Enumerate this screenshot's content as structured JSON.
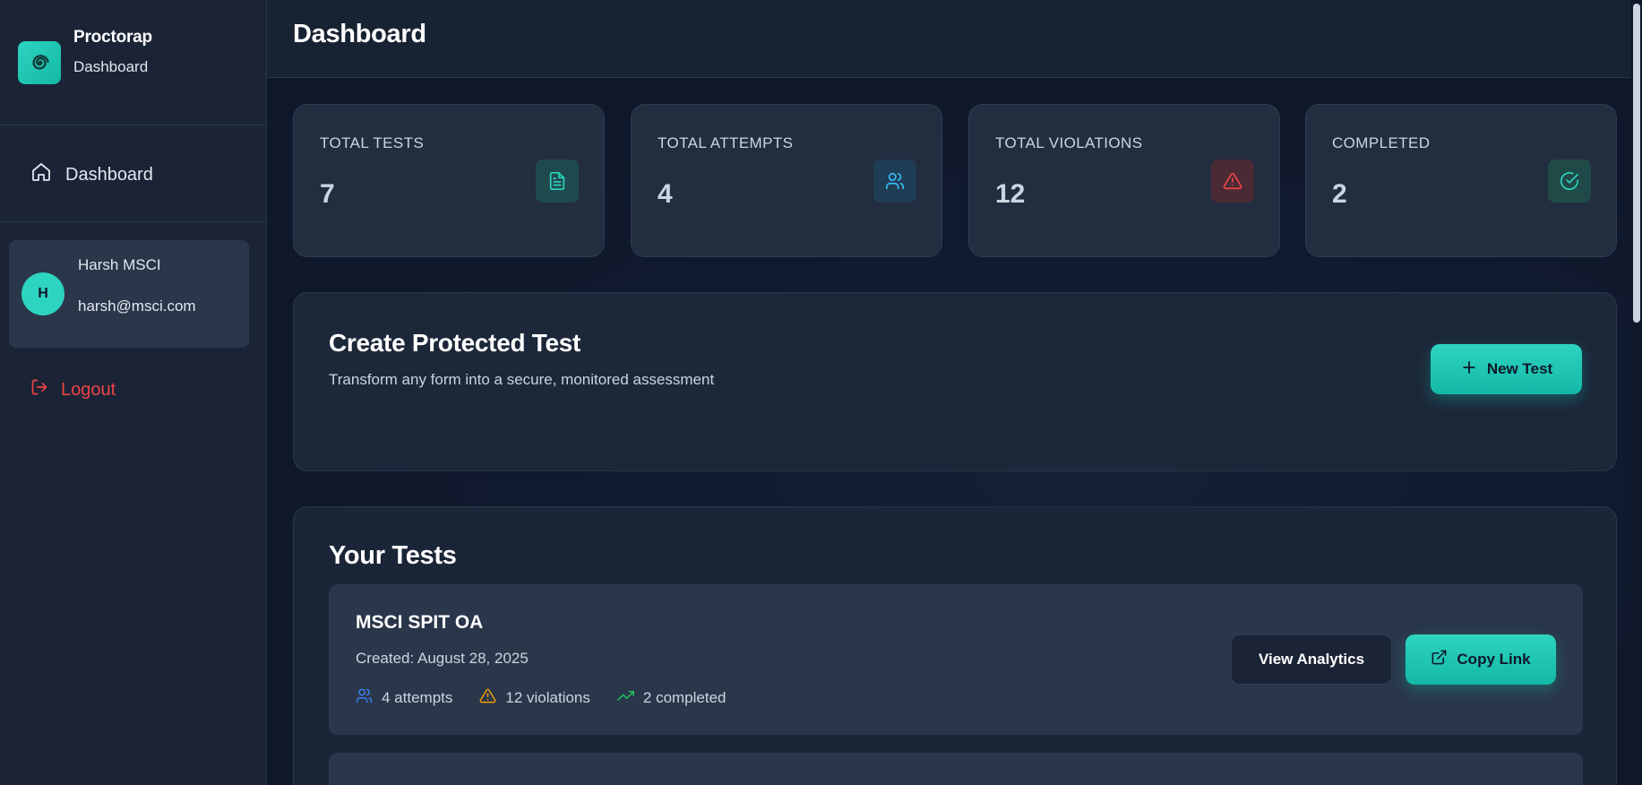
{
  "sidebar": {
    "brand_name": "Proctorap",
    "brand_subtitle": "Dashboard",
    "nav_items": [
      {
        "label": "Dashboard",
        "icon": "home-icon"
      }
    ],
    "user": {
      "initial": "H",
      "name": "Harsh MSCI",
      "email": "harsh@msci.com"
    },
    "logout_label": "Logout"
  },
  "header": {
    "title": "Dashboard"
  },
  "stats": [
    {
      "label": "TOTAL TESTS",
      "value": "7",
      "icon": "file-text-icon",
      "color": "#2dd4bf"
    },
    {
      "label": "TOTAL ATTEMPTS",
      "value": "4",
      "icon": "users-icon",
      "color": "#38bdf8"
    },
    {
      "label": "TOTAL VIOLATIONS",
      "value": "12",
      "icon": "alert-triangle-icon",
      "color": "#ef4444"
    },
    {
      "label": "COMPLETED",
      "value": "2",
      "icon": "check-circle-icon",
      "color": "#2dd4bf"
    }
  ],
  "create": {
    "title": "Create Protected Test",
    "description": "Transform any form into a secure, monitored assessment",
    "button_label": "New Test"
  },
  "tests": {
    "title": "Your Tests",
    "items": [
      {
        "name": "MSCI SPIT OA",
        "created": "Created: August 28, 2025",
        "attempts": "4 attempts",
        "violations": "12 violations",
        "completed": "2 completed",
        "analytics_label": "View Analytics",
        "copy_label": "Copy Link"
      }
    ]
  },
  "colors": {
    "accent": "#2dd4bf",
    "danger": "#ef4444",
    "warning": "#f59e0b",
    "success": "#22c55e",
    "info": "#3b82f6"
  }
}
